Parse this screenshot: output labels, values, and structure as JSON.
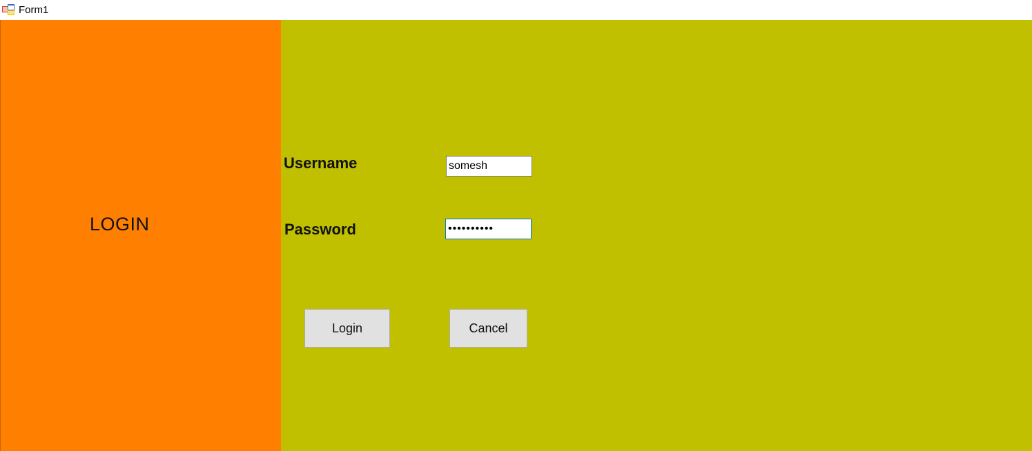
{
  "window": {
    "title": "Form1",
    "icon": "winforms-app-icon"
  },
  "left_panel": {
    "heading": "LOGIN",
    "color": "#ff7f00"
  },
  "right_panel": {
    "color": "#c0c000"
  },
  "form": {
    "username_label": "Username",
    "username_value": "somesh",
    "password_label": "Password",
    "password_value": "••••••••••"
  },
  "buttons": {
    "login_label": "Login",
    "cancel_label": "Cancel"
  }
}
